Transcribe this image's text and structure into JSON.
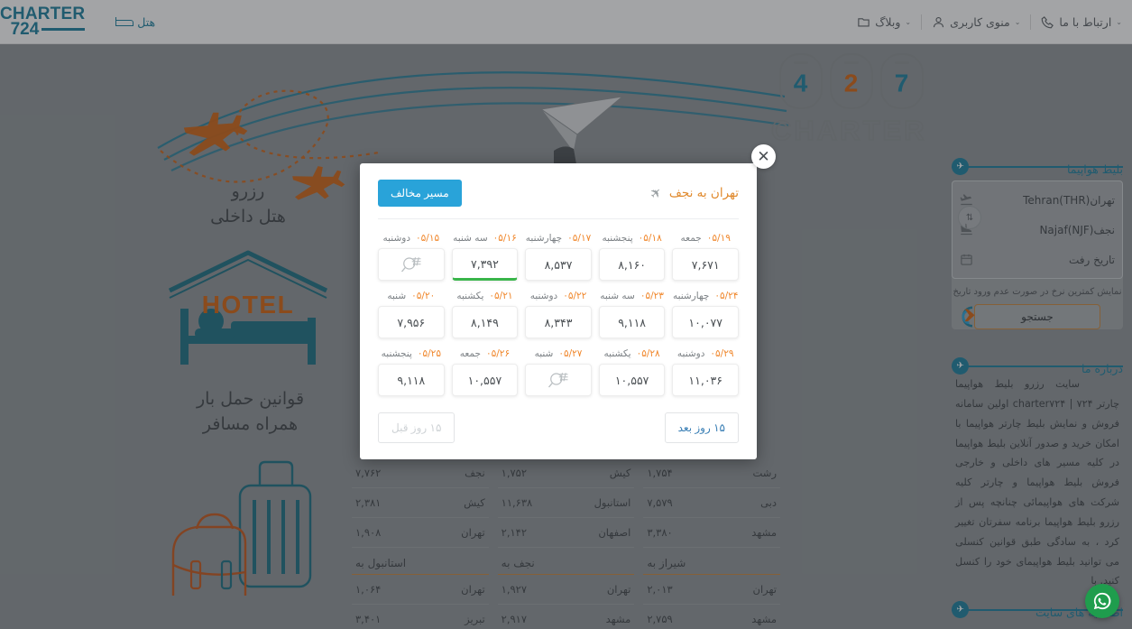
{
  "header": {
    "logo_top": "CHARTER",
    "logo_bottom": "724",
    "hotel_label": "هتل",
    "nav": [
      {
        "label": "ارتباط با ما",
        "icon": "phone-icon",
        "caret": "⌄"
      },
      {
        "label": "منوی کاربری",
        "icon": "user-icon",
        "caret": "⌄"
      },
      {
        "label": "وبلاگ",
        "icon": "folder-icon",
        "caret": ""
      }
    ]
  },
  "hero": {
    "hotel_caption_line1": "رزرو",
    "hotel_caption_line2": "هتل داخلی",
    "hotel_word": "HOTEL",
    "bag_caption_line1": "قوانین حمل بار",
    "bag_caption_line2": "همراه مسافر",
    "windows": [
      {
        "digit": "7",
        "color": "#1a7f9e"
      },
      {
        "digit": "2",
        "color": "#d2620f"
      },
      {
        "digit": "4",
        "color": "#1a7f9e"
      }
    ],
    "charter_outline": "CHARTER"
  },
  "sidebar": {
    "panels": [
      {
        "title": "بلیط هواپیما",
        "badge": "✈"
      },
      {
        "title": "درباره ما",
        "badge": "✈"
      },
      {
        "title": "اطلاعیه های سایت",
        "badge": "✈"
      }
    ],
    "flight_form": {
      "origin": "تهران(Tehran(THR",
      "destination": "نجف(Najaf(NJF",
      "date_placeholder": "تاریخ رفت",
      "swap_icon": "swap-icon",
      "hint": "نمایش کمترین نرخ در صورت عدم ورود تاریخ",
      "search_label": "جستجو"
    },
    "about_text": "سایت رزرو بلیط هواپیما چارتر ۷۲۴ | charter۷۲۴ اولین سامانه فروش و نمایش بلیط چارتر هواپیما با امکان خرید و صدور آنلاین بلیط هواپیما در کلیه مسیر های داخلی و خارجی فروش بلیط هواپیما و چارتر کلیه شرکت های هواپیمائی چنانچه پس از رزرو بلیط هواپیما برنامه سفرتان تغییر کرد ، به سادگی طبق قوانین کنسلی می توانید بلیط هواپیمای خود را کنسل کنید. با"
  },
  "background_tables": [
    {
      "head": "شیراز به",
      "rows": [
        {
          "city": "تهران",
          "price": "۲,۰۱۳"
        },
        {
          "city": "مشهد",
          "price": "۲,۷۵۹"
        }
      ]
    },
    {
      "head": "نجف به",
      "rows": [
        {
          "city": "تهران",
          "price": "۱,۹۲۷"
        },
        {
          "city": "مشهد",
          "price": "۲,۹۱۷"
        }
      ]
    },
    {
      "head": "استانبول به",
      "rows": [
        {
          "city": "تهران",
          "price": "۱,۰۶۴"
        },
        {
          "city": "تبریز",
          "price": "۳,۴۰۱"
        }
      ]
    }
  ],
  "background_tables_upper": [
    {
      "rows": [
        {
          "city": "رشت",
          "price": "۱,۷۵۴"
        },
        {
          "city": "دبی",
          "price": "۷,۵۷۹"
        },
        {
          "city": "مشهد",
          "price": "۳,۳۸۰"
        }
      ]
    },
    {
      "rows": [
        {
          "city": "کیش",
          "price": "۱,۷۵۲"
        },
        {
          "city": "استانبول",
          "price": "۱۱,۶۳۸"
        },
        {
          "city": "اصفهان",
          "price": "۲,۱۴۲"
        }
      ]
    },
    {
      "rows": [
        {
          "city": "نجف",
          "price": "۷,۷۶۲"
        },
        {
          "city": "کیش",
          "price": "۲,۳۸۱"
        },
        {
          "city": "تهران",
          "price": "۱,۹۰۸"
        }
      ]
    }
  ],
  "modal": {
    "title": "تهران به نجف",
    "plane_icon": "plane-icon",
    "swap_route_label": "مسیر مخالف",
    "close_icon": "close-icon",
    "next_label": "۱۵ روز بعد",
    "prev_label": "۱۵ روز قبل",
    "prev_disabled": true,
    "cells": [
      {
        "day": "جمعه",
        "date": "۰۵/۱۹",
        "price": "۷,۶۷۱",
        "state": "normal"
      },
      {
        "day": "پنجشنبه",
        "date": "۰۵/۱۸",
        "price": "۸,۱۶۰",
        "state": "normal"
      },
      {
        "day": "چهارشنبه",
        "date": "۰۵/۱۷",
        "price": "۸,۵۳۷",
        "state": "normal"
      },
      {
        "day": "سه شنبه",
        "date": "۰۵/۱۶",
        "price": "۷,۳۹۲",
        "state": "selected"
      },
      {
        "day": "دوشنبه",
        "date": "۰۵/۱۵",
        "price": "",
        "state": "noresult"
      },
      {
        "day": "چهارشنبه",
        "date": "۰۵/۲۴",
        "price": "۱۰,۰۷۷",
        "state": "normal"
      },
      {
        "day": "سه شنبه",
        "date": "۰۵/۲۳",
        "price": "۹,۱۱۸",
        "state": "normal"
      },
      {
        "day": "دوشنبه",
        "date": "۰۵/۲۲",
        "price": "۸,۳۴۳",
        "state": "normal"
      },
      {
        "day": "یکشنبه",
        "date": "۰۵/۲۱",
        "price": "۸,۱۴۹",
        "state": "normal"
      },
      {
        "day": "شنبه",
        "date": "۰۵/۲۰",
        "price": "۷,۹۵۶",
        "state": "normal"
      },
      {
        "day": "دوشنبه",
        "date": "۰۵/۲۹",
        "price": "۱۱,۰۳۶",
        "state": "normal"
      },
      {
        "day": "یکشنبه",
        "date": "۰۵/۲۸",
        "price": "۱۰,۵۵۷",
        "state": "normal"
      },
      {
        "day": "شنبه",
        "date": "۰۵/۲۷",
        "price": "",
        "state": "noresult"
      },
      {
        "day": "جمعه",
        "date": "۰۵/۲۶",
        "price": "۱۰,۵۵۷",
        "state": "normal"
      },
      {
        "day": "پنجشنبه",
        "date": "۰۵/۲۵",
        "price": "۹,۱۱۸",
        "state": "normal"
      }
    ]
  },
  "fab": {
    "icon": "whatsapp-icon"
  },
  "colors": {
    "brand": "#1a7f9e",
    "accent_orange": "#d2620f",
    "modal_title": "#e0892c",
    "swap_button": "#29a3d9",
    "selected_underline": "#39b54a",
    "whatsapp": "#1f9d4d"
  }
}
